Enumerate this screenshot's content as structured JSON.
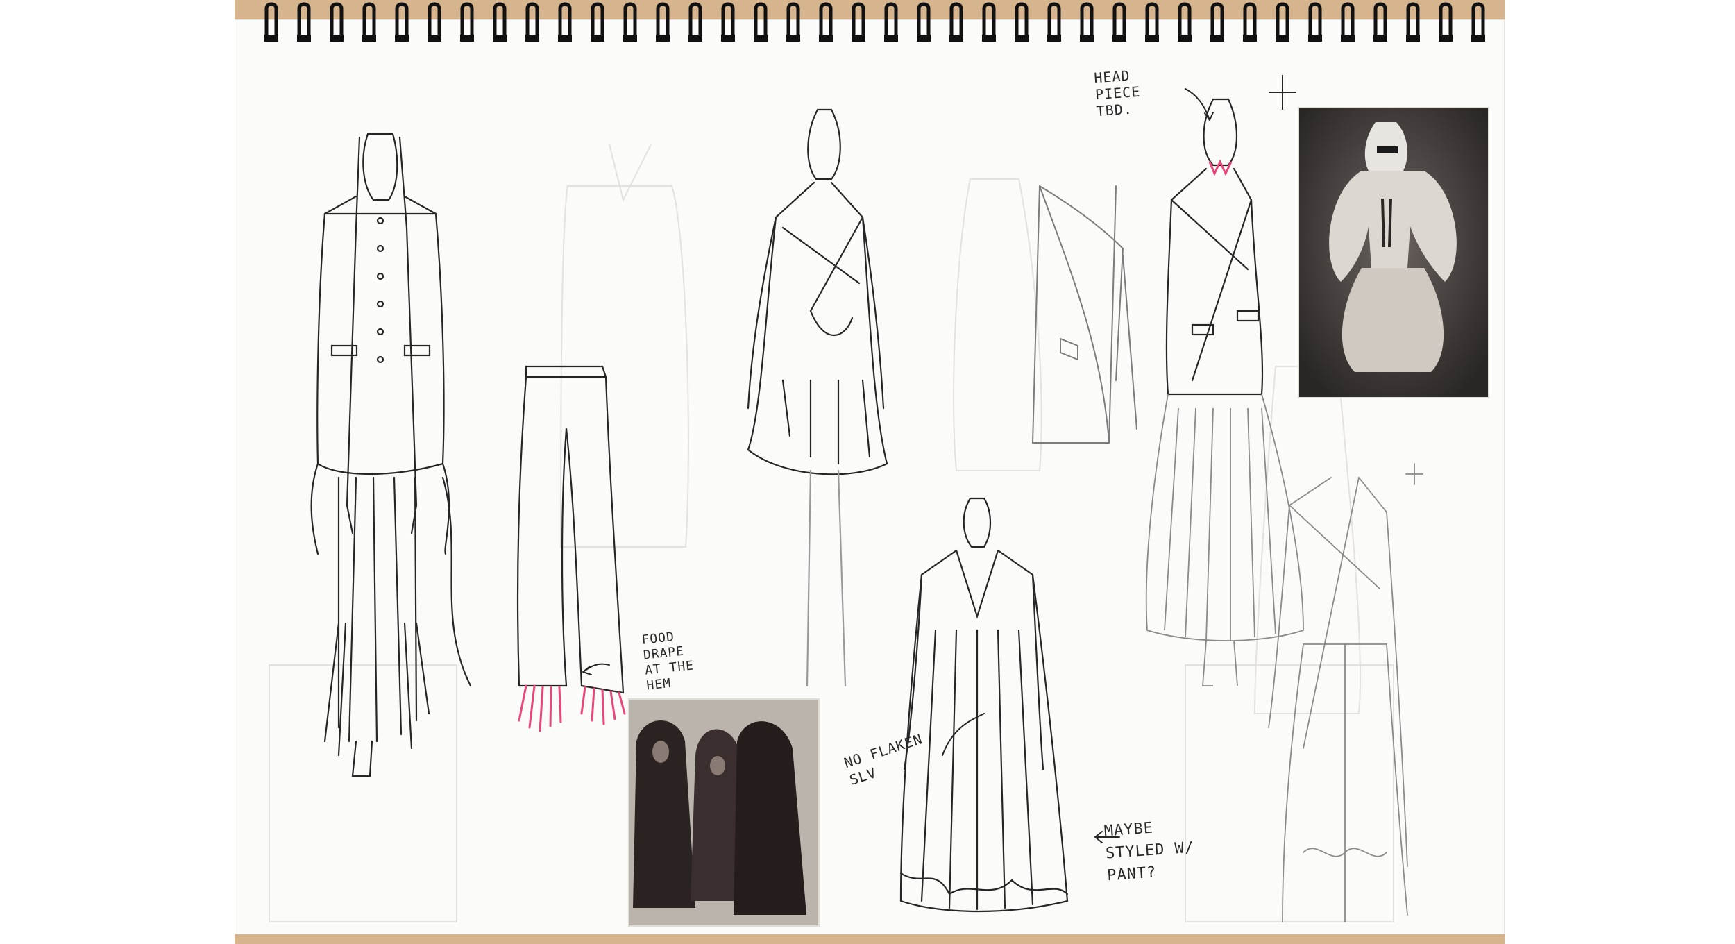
{
  "sketchbook": {
    "paper_color": "#fbfbfa",
    "cover_color": "#d6b48e",
    "ink_color": "#2a2a2a",
    "pencil_color": "#8a8a8a",
    "accent_marker_color": "#e8477a"
  },
  "annotations": {
    "hem_note": "FOOD\nDRAPE\nAT THE\nHEM",
    "head_note": "HEAD\nPIECE\nTBD.",
    "sleeve_note": "NO FLAKEN\nSLV",
    "styling_note": "MAYBE\nSTYLED W/\nPANT?"
  },
  "reference_photos": [
    {
      "subject": "three hooded figures in long dark robes"
    },
    {
      "subject": "veiled figure in pale draped robe and harem trousers"
    }
  ]
}
